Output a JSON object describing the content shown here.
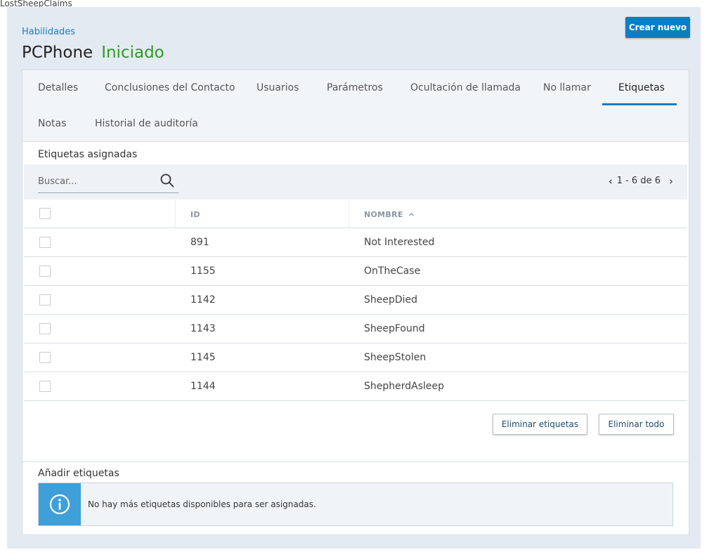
{
  "background": {
    "window_title": "LostSheepClaims"
  },
  "header": {
    "breadcrumb": "Habilidades",
    "title": "PCPhone",
    "status": "Iniciado",
    "create_button": "Crear nuevo"
  },
  "tabs": [
    {
      "label": "Detalles",
      "active": false
    },
    {
      "label": "Conclusiones del Contacto",
      "active": false
    },
    {
      "label": "Usuarios",
      "active": false
    },
    {
      "label": "Parámetros",
      "active": false
    },
    {
      "label": "Ocultación de llamada",
      "active": false
    },
    {
      "label": "No llamar",
      "active": false
    },
    {
      "label": "Etiquetas",
      "active": true
    },
    {
      "label": "Notas",
      "active": false
    },
    {
      "label": "Historial de auditoría",
      "active": false
    }
  ],
  "assigned": {
    "section_title": "Etiquetas asignadas",
    "search_placeholder": "Buscar...",
    "pager": {
      "range": "1 - 6 de 6",
      "prev_icon": "chevron-left-icon",
      "next_icon": "chevron-right-icon"
    },
    "columns": {
      "id": "ID",
      "name": "NOMBRE",
      "sort_icon": "sort-ascending-icon"
    },
    "rows": [
      {
        "id": "891",
        "name": "Not Interested"
      },
      {
        "id": "1155",
        "name": "OnTheCase"
      },
      {
        "id": "1142",
        "name": "SheepDied"
      },
      {
        "id": "1143",
        "name": "SheepFound"
      },
      {
        "id": "1145",
        "name": "SheepStolen"
      },
      {
        "id": "1144",
        "name": "ShepherdAsleep"
      }
    ],
    "remove_tags_button": "Eliminar etiquetas",
    "remove_all_button": "Eliminar todo"
  },
  "add": {
    "section_title": "Añadir etiquetas",
    "info_icon": "info-icon",
    "info_message": "No hay más etiquetas disponibles para ser asignadas."
  },
  "colors": {
    "accent": "#1a7ec4",
    "status_green": "#2f9a1e",
    "primary_button": "#0a7fc2",
    "info_blue": "#3f9fd8"
  }
}
